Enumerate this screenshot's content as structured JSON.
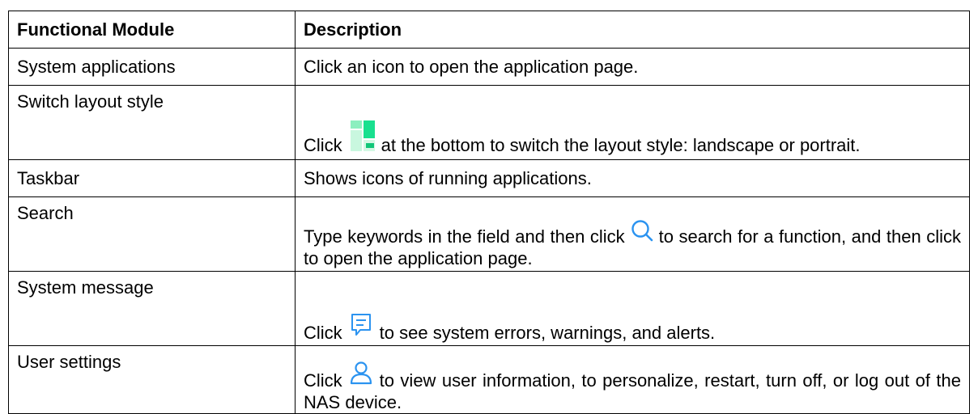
{
  "table": {
    "headers": {
      "module": "Functional Module",
      "description": "Description"
    },
    "rows": [
      {
        "module": "System applications",
        "desc_before": "Click an icon to open the application page.",
        "desc_after": "",
        "icon": null
      },
      {
        "module": "Switch layout style",
        "desc_before": "Click",
        "desc_after": "at the bottom to switch the layout style: landscape or portrait.",
        "icon": "layout-switch-icon"
      },
      {
        "module": "Taskbar",
        "desc_before": "Shows icons of running applications.",
        "desc_after": "",
        "icon": null
      },
      {
        "module": "Search",
        "desc_before": "Type keywords in the field and then click",
        "desc_after": "to search for a function, and then click to open the application page.",
        "icon": "search-icon"
      },
      {
        "module": "System message",
        "desc_before": "Click",
        "desc_after": "to see system errors, warnings, and alerts.",
        "icon": "message-icon"
      },
      {
        "module": "User settings",
        "desc_before": "Click",
        "desc_after": "to view user information, to personalize, restart, turn off, or log out of the NAS device.",
        "icon": "user-icon"
      }
    ]
  },
  "colors": {
    "icon_green": "#19e08f",
    "icon_blue": "#2b93f0",
    "border": "#000000"
  }
}
